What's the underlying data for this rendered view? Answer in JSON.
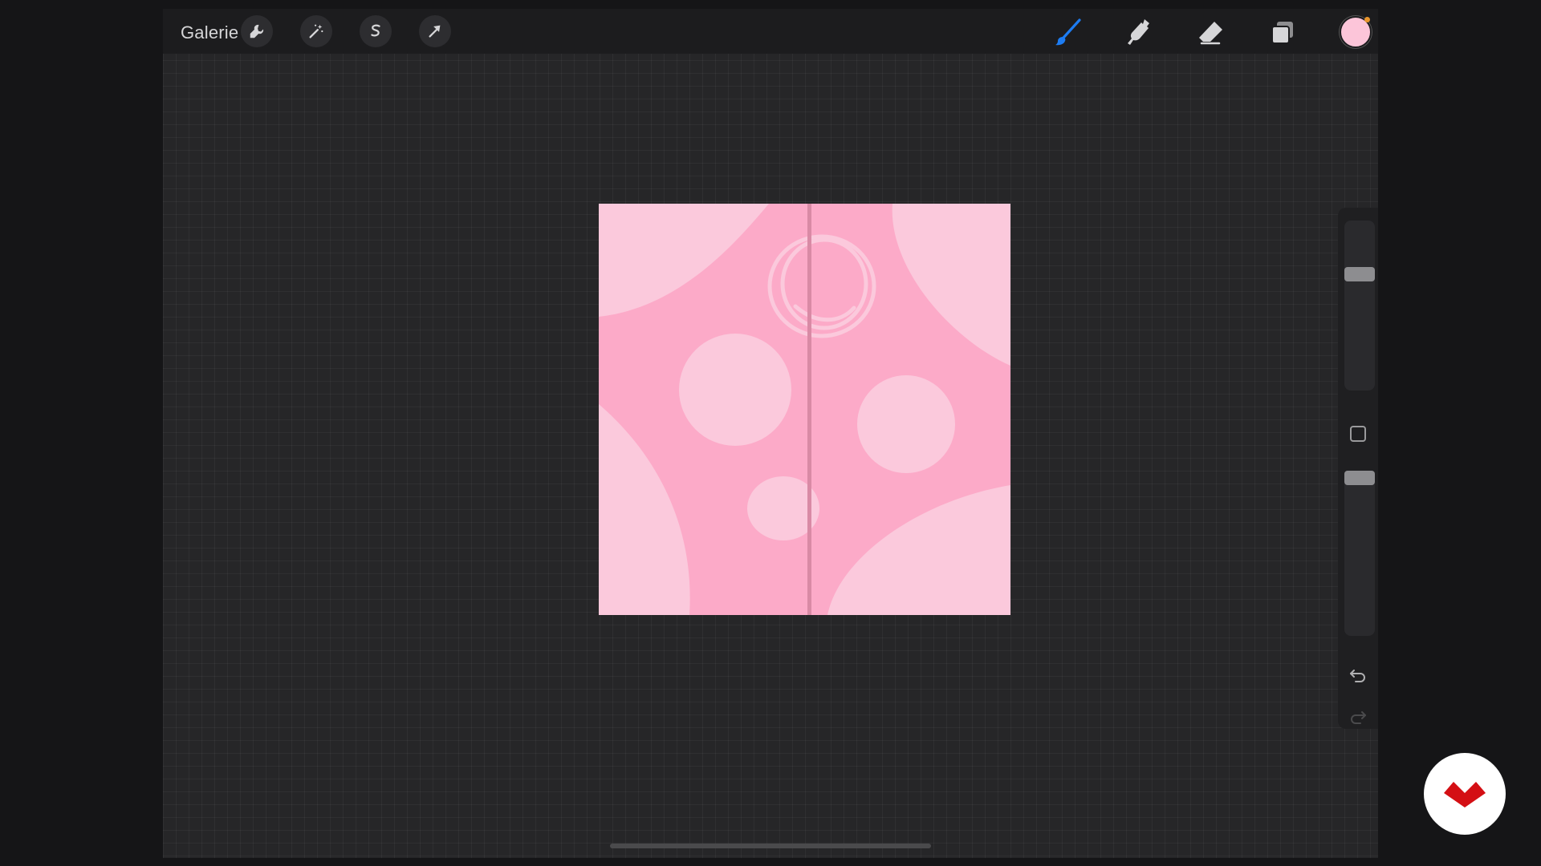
{
  "topbar": {
    "gallery_label": "Galerie",
    "left_tools": [
      "wrench-icon",
      "magic-wand-icon",
      "selection-icon",
      "transform-arrow-icon"
    ],
    "right_tools": [
      "brush-icon",
      "smudge-icon",
      "eraser-icon",
      "layers-icon"
    ],
    "current_color": "#fcc5d9",
    "active_tool": "brush"
  },
  "canvas": {
    "background_color": "#fcaac8",
    "shape_color": "#fbc9dc",
    "divider_color": "#d98aa5"
  },
  "sidebar": {
    "brush_size_level": 0.3,
    "opacity_level": 0.0,
    "modify_icon": "square-icon",
    "undo_icon": "undo-icon",
    "redo_icon": "redo-icon"
  },
  "colors": {
    "accent": "#1d7cf2",
    "badge": "#d40f14"
  }
}
